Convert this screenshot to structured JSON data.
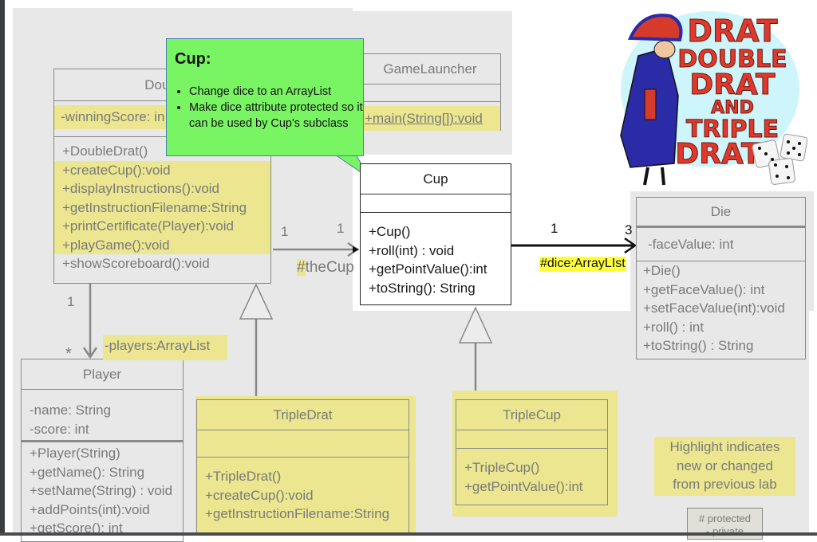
{
  "callout": {
    "title": "Cup:",
    "bullets": [
      "Change dice to an ArrayList",
      "Make dice attribute protected so it can be used by Cup's subclass"
    ]
  },
  "classes": {
    "double_drat": {
      "name": "DoubleDrat",
      "visible_name": "Doubl",
      "attributes": [
        "-winningScore: in"
      ],
      "methods": [
        "+DoubleDrat()",
        "+createCup():void",
        "+displayInstructions():void",
        "+getInstructionFilename:String",
        "+printCertificate(Player):void",
        "+playGame():void",
        "+showScoreboard():void"
      ]
    },
    "game_launcher": {
      "name": "GameLauncher",
      "methods": [
        "+main(String[]):void"
      ]
    },
    "cup": {
      "name": "Cup",
      "methods": [
        "+Cup()",
        "+roll(int) : void",
        "+getPointValue():int",
        "+toString(): String"
      ]
    },
    "die": {
      "name": "Die",
      "attributes": [
        "-faceValue: int"
      ],
      "methods": [
        "+Die()",
        "+getFaceValue(): int",
        "+setFaceValue(int):void",
        "+roll() : int",
        "+toString() : String"
      ]
    },
    "player": {
      "name": "Player",
      "attributes": [
        "-name: String",
        "-score: int"
      ],
      "methods": [
        "+Player(String)",
        "+getName(): String",
        "+setName(String) : void",
        "+addPoints(int):void",
        "+getScore(): int"
      ]
    },
    "triple_drat": {
      "name": "TripleDrat",
      "methods": [
        "+TripleDrat()",
        "+createCup():void",
        "+getInstructionFilename:String"
      ]
    },
    "triple_cup": {
      "name": "TripleCup",
      "methods": [
        "+TripleCup()",
        "+getPointValue():int"
      ]
    }
  },
  "associations": {
    "drat_cup": {
      "mult_source": "1",
      "mult_target": "1",
      "role_hash": "#",
      "role_rest": "theCup"
    },
    "cup_die": {
      "mult_source": "1",
      "mult_target": "3",
      "role": "#dice:ArrayLIst"
    },
    "drat_player": {
      "mult_source": "1",
      "mult_target": "*",
      "role": "-players:ArrayList"
    }
  },
  "legend": {
    "highlight_note": [
      "Highlight indicates",
      "new or changed",
      "from previous lab"
    ],
    "visibility": [
      "# protected",
      "- private"
    ]
  },
  "logo": {
    "lines": [
      "DRAT",
      "DOUBLE",
      "DRAT",
      "AND",
      "TRIPLE",
      "DRAT"
    ]
  },
  "colors": {
    "highlight": "#ebe68f",
    "callout": "#79f463",
    "panel": "#e8e8e8",
    "logo_red": "#e0392b",
    "logo_blue": "#2a2a9a",
    "dice_yellow_highlight": "#ffff3a"
  }
}
